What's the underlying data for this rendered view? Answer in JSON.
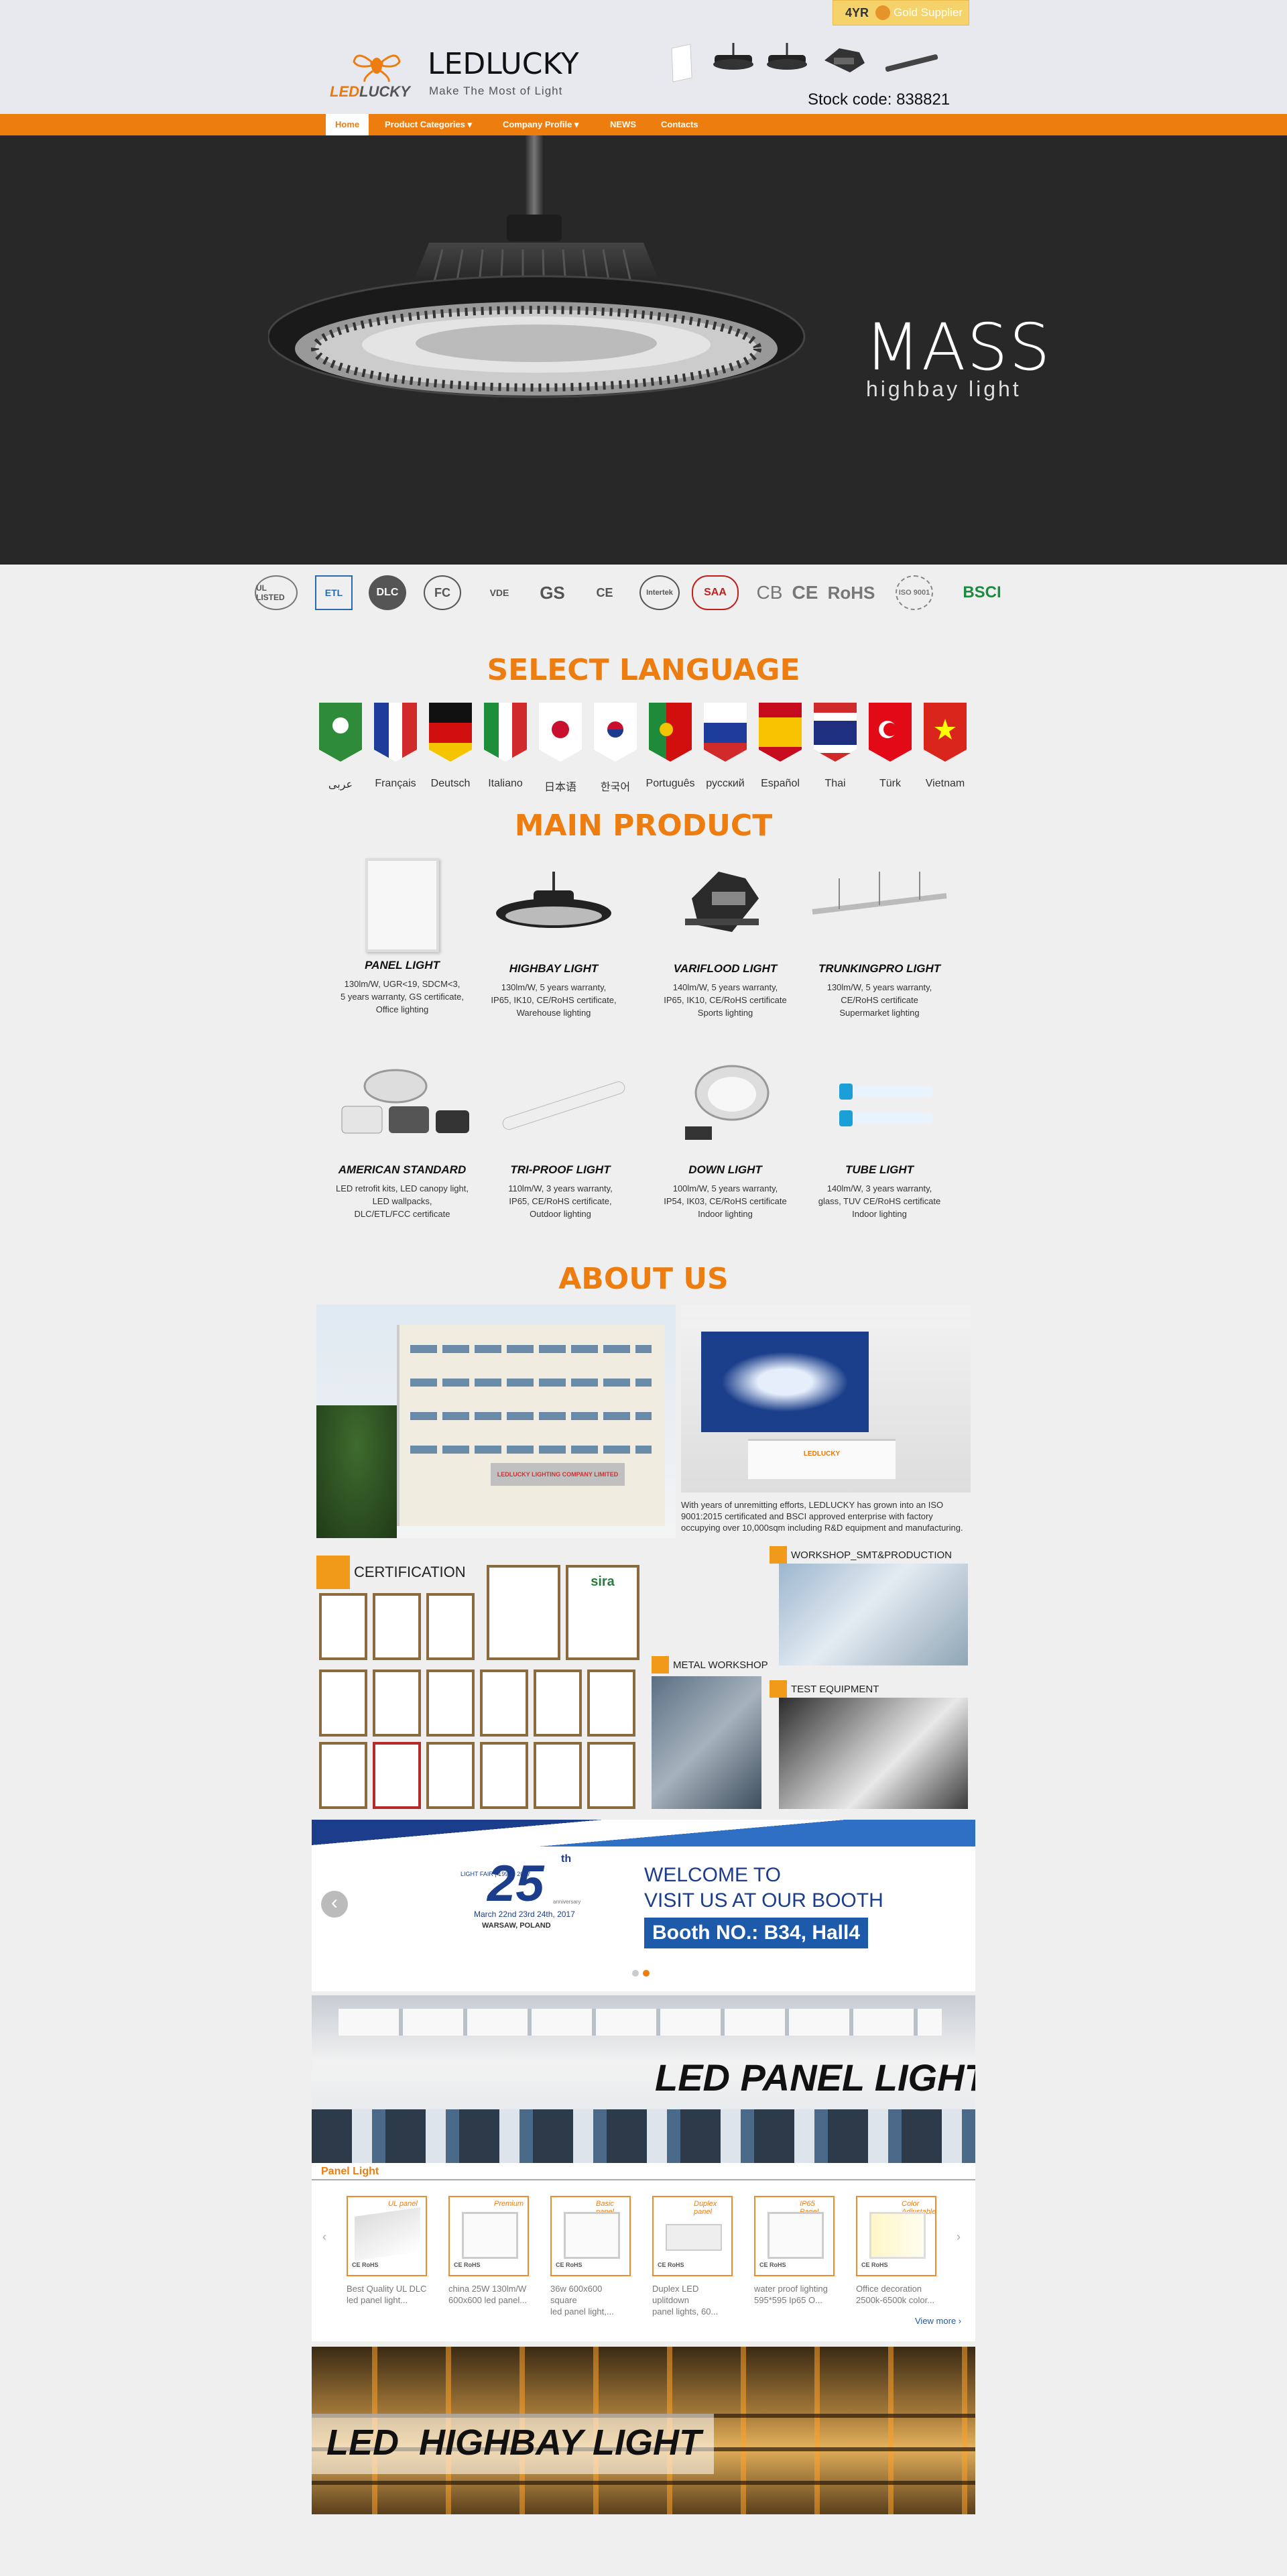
{
  "header": {
    "supplier_years": "4YR",
    "supplier_badge": "Gold Supplier",
    "logo_prefix": "LED",
    "logo_suffix": "LUCKY",
    "site_name": "LEDLUCKY",
    "tagline": "Make The Most of Light",
    "stock_code": "Stock code: 838821"
  },
  "nav": {
    "items": [
      {
        "label": "Home"
      },
      {
        "label": "Product Categories ▾"
      },
      {
        "label": "Company Profile ▾"
      },
      {
        "label": "NEWS"
      },
      {
        "label": "Contacts"
      }
    ]
  },
  "hero": {
    "title": "MASS",
    "subtitle": "highbay light"
  },
  "certifications": [
    "UL LISTED",
    "ETL",
    "DLC",
    "FC",
    "VDE",
    "GS",
    "CE",
    "Intertek",
    "SAA",
    "CB",
    "CE",
    "RoHS",
    "ISO 9001",
    "BSCI"
  ],
  "language_section": {
    "heading": "SELECT LANGUAGE",
    "languages": [
      "عربى",
      "Français",
      "Deutsch",
      "Italiano",
      "日本语",
      "한국어",
      "Português",
      "русский",
      "Español",
      "Thai",
      "Türk",
      "Vietnam"
    ]
  },
  "main_product": {
    "heading": "MAIN PRODUCT",
    "items": [
      {
        "title": "PANEL LIGHT",
        "d1": "130lm/W, UGR<19, SDCM<3,",
        "d2": "5 years warranty, GS certificate,",
        "d3": "Office lighting"
      },
      {
        "title": "HIGHBAY LIGHT",
        "d1": "130lm/W, 5 years warranty,",
        "d2": "IP65, IK10, CE/RoHS certificate,",
        "d3": "Warehouse lighting"
      },
      {
        "title": "VARIFLOOD LIGHT",
        "d1": "140lm/W, 5 years warranty,",
        "d2": "IP65, IK10, CE/RoHS certificate",
        "d3": "Sports lighting"
      },
      {
        "title": "TRUNKINGPRO LIGHT",
        "d1": "130lm/W, 5 years warranty,",
        "d2": "CE/RoHS certificate",
        "d3": "Supermarket lighting"
      },
      {
        "title": "AMERICAN STANDARD",
        "d1": "LED retrofit kits, LED canopy light,",
        "d2": "LED wallpacks,",
        "d3": "DLC/ETL/FCC certificate"
      },
      {
        "title": "TRI-PROOF LIGHT",
        "d1": "110lm/W, 3 years warranty,",
        "d2": "IP65, CE/RoHS certificate,",
        "d3": "Outdoor lighting"
      },
      {
        "title": "DOWN LIGHT",
        "d1": "100lm/W, 5 years warranty,",
        "d2": "IP54, IK03, CE/RoHS certificate",
        "d3": "Indoor lighting"
      },
      {
        "title": "TUBE LIGHT",
        "d1": "140lm/W, 3 years warranty,",
        "d2": "glass, TUV CE/RoHS certificate",
        "d3": "Indoor lighting"
      }
    ]
  },
  "about": {
    "heading": "ABOUT US",
    "text": "With years of unremitting efforts, LEDLUCKY has grown into an ISO 9001:2015 certificated and BSCI approved enterprise with factory occupying over 10,000sqm including R&D equipment and manufacturing.",
    "building_sign": "LEDLUCKY LIGHTING COMPANY LIMITED",
    "reception_sign": "LEDLUCKY",
    "labels": {
      "certification": "CERTIFICATION",
      "workshop": "WORKSHOP_SMT&PRODUCTION",
      "metal": "METAL WORKSHOP",
      "test": "TEST EQUIPMENT"
    },
    "sira": "sira"
  },
  "fair_banner": {
    "fair_number": "25",
    "fair_suffix": "th",
    "fair_name": "LIGHT FAIR | 1993 - 2017",
    "fair_anniversary": "anniversary",
    "dates": "March 22nd 23rd 24th, 2017",
    "city": "WARSAW, POLAND",
    "welcome": "WELCOME TO",
    "visit": "VISIT US AT OUR BOOTH",
    "booth": "Booth NO.: B34, Hall4"
  },
  "panel_section": {
    "banner_title": "LED PANEL LIGHT",
    "tab_label": "Panel Light",
    "view_more": "View more ›",
    "thumb_titles": [
      "UL panel",
      "Premium",
      "Basic panel",
      "Duplex panel",
      "IP65 Panel",
      "Color Adjustable"
    ],
    "thumb_badges": [
      "CE RoHS",
      "CE RoHS",
      "CE RoHS",
      "CE RoHS",
      "CE RoHS",
      "CE RoHS"
    ],
    "products": [
      {
        "l1": "Best Quality UL DLC",
        "l2": "led panel light..."
      },
      {
        "l1": "china 25W 130lm/W",
        "l2": "600x600 led panel..."
      },
      {
        "l1": "36w 600x600 square",
        "l2": "led panel light,..."
      },
      {
        "l1": "Duplex LED uplitdown",
        "l2": "panel lights, 60..."
      },
      {
        "l1": "water proof lighting",
        "l2": "595*595 Ip65 O..."
      },
      {
        "l1": "Office decoration",
        "l2": "2500k-6500k color..."
      }
    ]
  },
  "highbay_section": {
    "banner_title": "LED  HIGHBAY LIGHT"
  },
  "colors": {
    "accent": "#ee7d10",
    "hero_bg": "#282828",
    "page_bg": "#efefef",
    "header_bg": "#e8e8ef"
  }
}
